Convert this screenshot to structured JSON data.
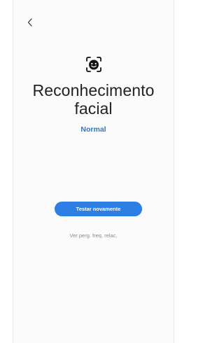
{
  "header": {
    "back_icon": "chevron-left-icon"
  },
  "main": {
    "icon": "face-scan-icon",
    "title": "Reconhecimento facial",
    "status": "Normal",
    "retest_button_label": "Testar novamente",
    "faq_link": "Ver perg. freq. relac."
  },
  "colors": {
    "accent": "#2D7FE3",
    "status_text": "#2F76C8",
    "title_text": "#222222",
    "muted_text": "#8A8A8A"
  }
}
